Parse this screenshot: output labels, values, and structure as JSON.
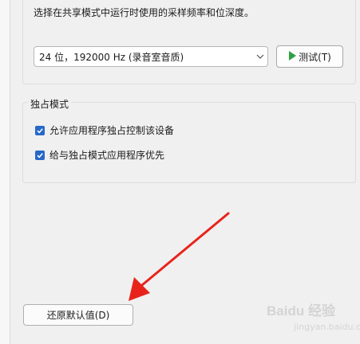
{
  "default_format": {
    "description": "选择在共享模式中运行时使用的采样频率和位深度。",
    "selected_format": "24 位，192000 Hz (录音室音质)",
    "test_button_label": "测试(T)"
  },
  "exclusive_mode": {
    "legend": "独占模式",
    "allow_exclusive_label": "允许应用程序独占控制该设备",
    "allow_exclusive_checked": true,
    "give_priority_label": "给与独占模式应用程序优先",
    "give_priority_checked": true
  },
  "restore_button_label": "还原默认值(D)",
  "watermark": {
    "text": "Baidu 经验",
    "sub": "jingyan.baidu.com"
  },
  "colors": {
    "accent": "#2769c9",
    "arrow": "#e8231b",
    "play_icon": "#2ea043"
  }
}
